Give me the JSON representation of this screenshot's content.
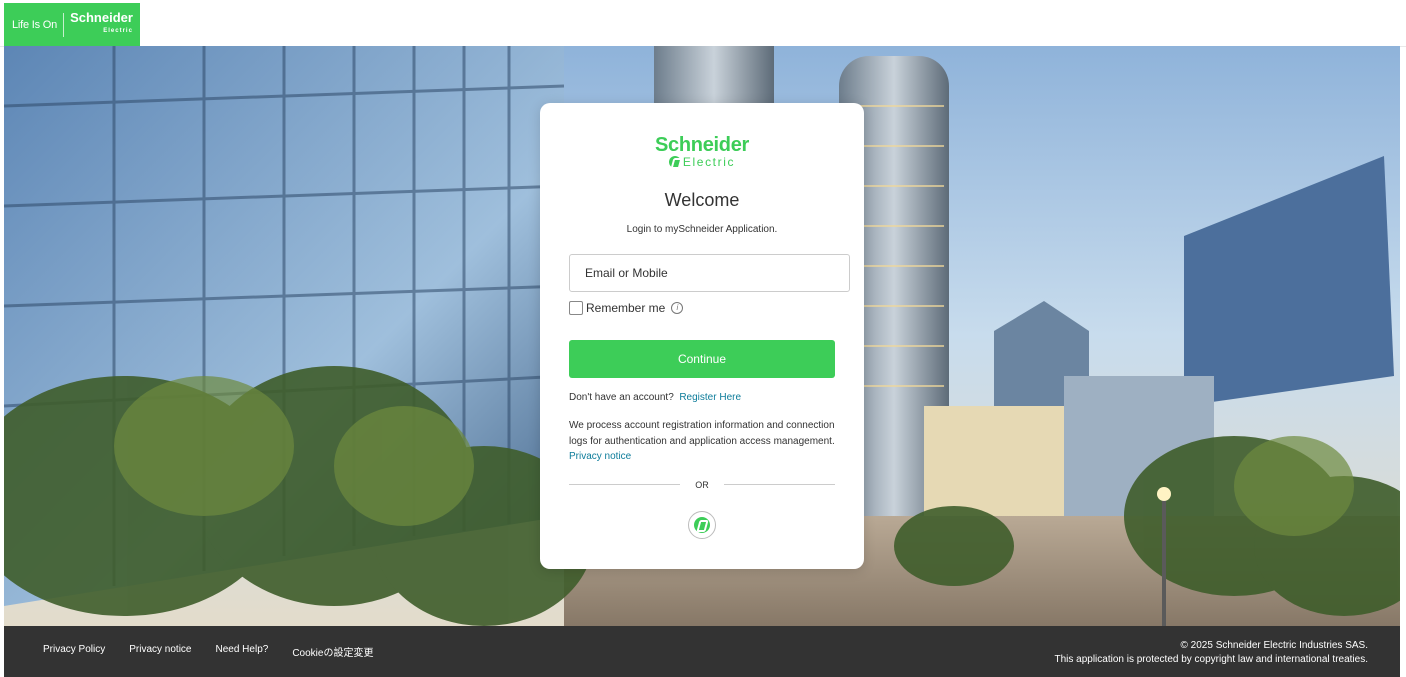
{
  "header": {
    "tagline": "Life Is On",
    "brand_name": "Schneider",
    "brand_sub": "Electric"
  },
  "card": {
    "logo_name": "Schneider",
    "logo_sub": "Electric",
    "title": "Welcome",
    "subtitle": "Login to mySchneider Application.",
    "email_placeholder": "Email or Mobile",
    "remember_label": "Remember me",
    "continue_label": "Continue",
    "no_account_text": "Don't have an account?",
    "register_link": "Register Here",
    "notice_text": "We process account registration information and connection logs for authentication and application access management.",
    "privacy_link": "Privacy notice",
    "or_text": "OR"
  },
  "footer": {
    "links": [
      "Privacy Policy",
      "Privacy notice",
      "Need Help?",
      "Cookieの設定変更"
    ],
    "copyright_line1": "© 2025 Schneider Electric Industries SAS.",
    "copyright_line2": "This application is protected by copyright law and international treaties."
  },
  "colors": {
    "brand_green": "#3dcd58",
    "link_teal": "#0d7c9a",
    "footer_bg": "#333333"
  }
}
